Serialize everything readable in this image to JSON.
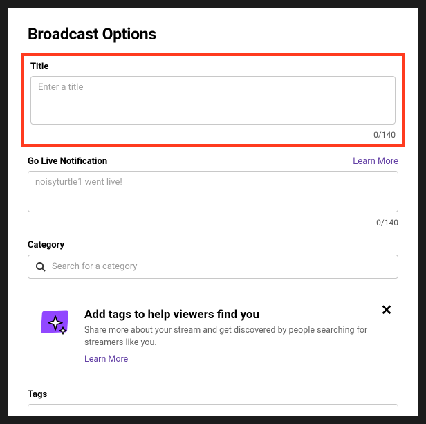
{
  "header": {
    "title": "Broadcast Options"
  },
  "title_field": {
    "label": "Title",
    "placeholder": "Enter a title",
    "value": "",
    "counter": "0/140"
  },
  "notification_field": {
    "label": "Go Live Notification",
    "learn_more": "Learn More",
    "placeholder": "noisyturtle1 went live!",
    "value": "",
    "counter": "0/140"
  },
  "category_field": {
    "label": "Category",
    "placeholder": "Search for a category",
    "value": ""
  },
  "tags_info": {
    "title": "Add tags to help viewers find you",
    "desc": "Share more about your stream and get discovered by people searching for streamers like you.",
    "learn_more": "Learn More"
  },
  "tags_field": {
    "label": "Tags"
  }
}
